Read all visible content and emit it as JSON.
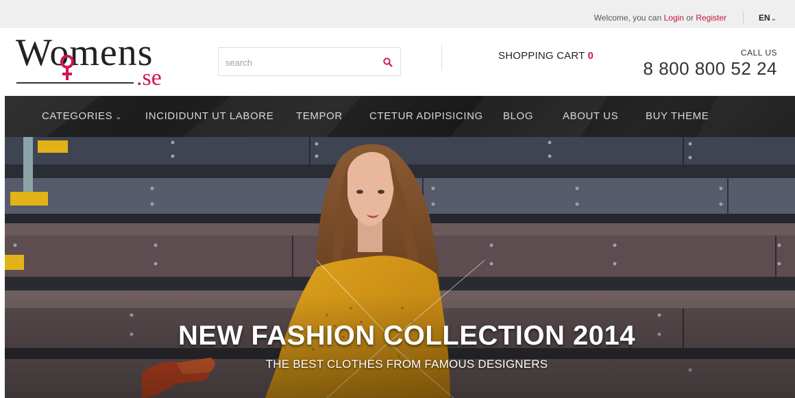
{
  "topbar": {
    "welcome_prefix": "Welcome, you can ",
    "login_label": "Login",
    "or_text": " or ",
    "register_label": "Register",
    "language": "EN"
  },
  "header": {
    "logo_text_main": "Womens",
    "logo_text_suffix": ".se",
    "search_placeholder": "search",
    "cart_label": "SHOPPING CART",
    "cart_count": "0",
    "call_label": "CALL US",
    "phone": "8 800 800 52 24"
  },
  "nav": {
    "items": [
      {
        "label": "CATEGORIES"
      },
      {
        "label": "INCIDIDUNT UT LABORE"
      },
      {
        "label": "TEMPOR"
      },
      {
        "label": "CTETUR ADIPISICING"
      },
      {
        "label": "BLOG"
      },
      {
        "label": "ABOUT US"
      },
      {
        "label": "BUY THEME"
      }
    ]
  },
  "hero": {
    "title": "NEW FASHION COLLECTION 2014",
    "subtitle": "THE BEST CLOTHES FROM FAMOUS DESIGNERS"
  },
  "colors": {
    "accent": "#d0174f",
    "link": "#c4123a",
    "nav_bg": "#242424",
    "topbar_bg": "#efefef"
  }
}
